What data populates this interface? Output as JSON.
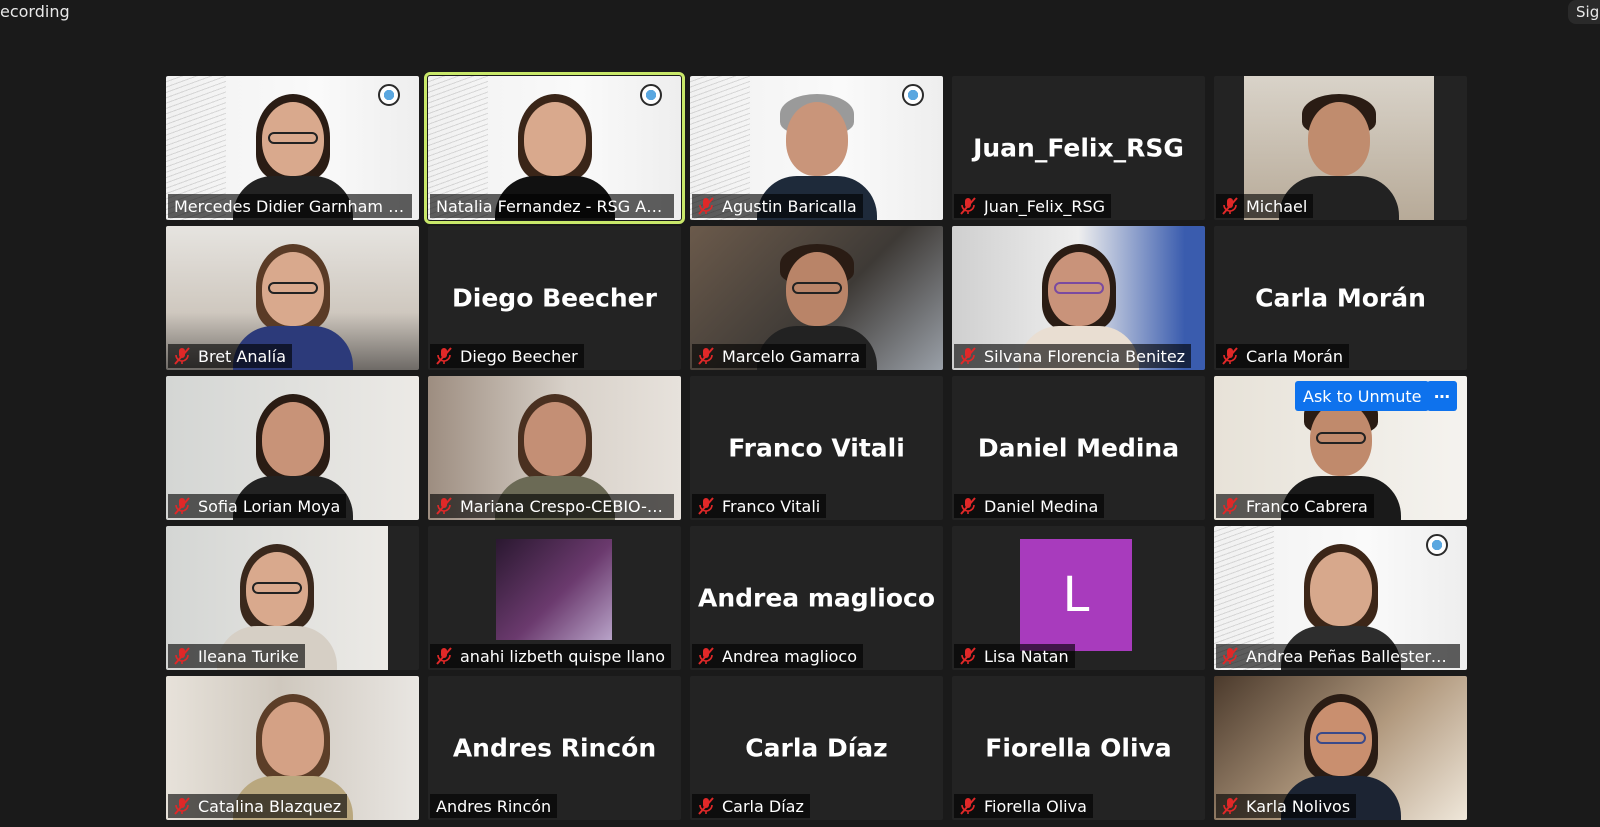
{
  "top_left_text": "ecording",
  "top_right_text": "Sig",
  "colors": {
    "speaking_outline": "#c9e86a",
    "mute_icon": "#e02828",
    "accent_blue": "#0e72ed",
    "avatar_purple": "#a83bbd"
  },
  "tiles": [
    {
      "name": "Mercedes Didier Garnham | ...",
      "muted": false
    },
    {
      "name": "Natalia Fernandez - RSG Arg...",
      "muted": false,
      "speaking": true
    },
    {
      "name": "Agustin Baricalla",
      "muted": true
    },
    {
      "name": "Juan_Felix_RSG",
      "muted": true,
      "center_name": "Juan_Felix_RSG"
    },
    {
      "name": "Michael",
      "muted": true
    },
    {
      "name": "Bret Analía",
      "muted": true
    },
    {
      "name": "Diego Beecher",
      "muted": true,
      "center_name": "Diego Beecher"
    },
    {
      "name": "Marcelo Gamarra",
      "muted": true
    },
    {
      "name": "Silvana Florencia Benitez",
      "muted": true
    },
    {
      "name": "Carla Morán",
      "muted": true,
      "center_name": "Carla Morán"
    },
    {
      "name": "Sofia Lorian Moya",
      "muted": true
    },
    {
      "name": "Mariana Crespo-CEBIO-U...",
      "muted": true
    },
    {
      "name": "Franco Vitali",
      "muted": true,
      "center_name": "Franco Vitali"
    },
    {
      "name": "Daniel Medina",
      "muted": true,
      "center_name": "Daniel Medina"
    },
    {
      "name": "Franco Cabrera",
      "muted": true,
      "ask_to_unmute": "Ask to Unmute",
      "more_icon": "ellipsis-icon"
    },
    {
      "name": "Ileana Turike",
      "muted": true
    },
    {
      "name": "anahi lizbeth quispe llano",
      "muted": true
    },
    {
      "name": "Andrea maglioco",
      "muted": true,
      "center_name": "Andrea maglioco"
    },
    {
      "name": "Lisa Natan",
      "muted": true,
      "avatar_letter": "L"
    },
    {
      "name": "Andrea Peñas Ballesteros...",
      "muted": true
    },
    {
      "name": "Catalina Blazquez",
      "muted": true
    },
    {
      "name": "Andres Rincón",
      "muted": false,
      "center_name": "Andres Rincón"
    },
    {
      "name": "Carla Díaz",
      "muted": true,
      "center_name": "Carla Díaz"
    },
    {
      "name": "Fiorella Oliva",
      "muted": true,
      "center_name": "Fiorella Oliva"
    },
    {
      "name": "Karla Nolivos",
      "muted": true
    }
  ]
}
